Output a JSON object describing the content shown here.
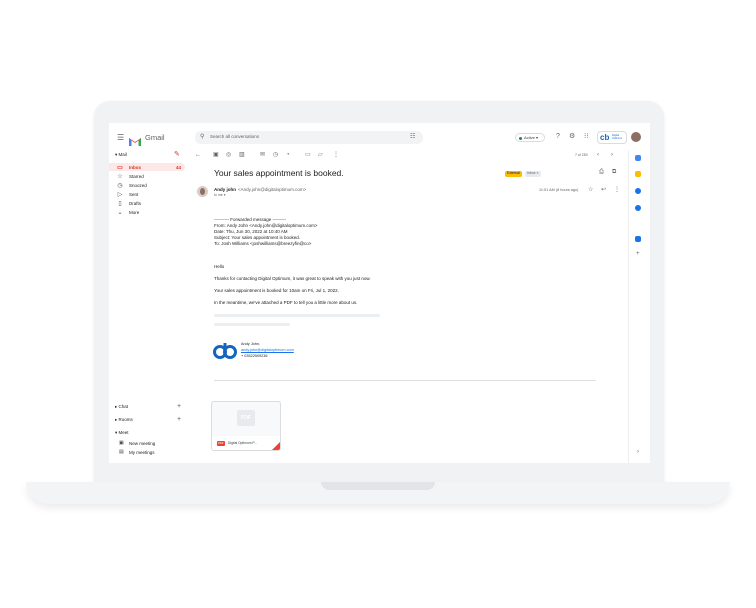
{
  "app": {
    "name": "Gmail"
  },
  "search": {
    "placeholder": "Search all conversations"
  },
  "status": {
    "label": "Active ▾"
  },
  "brand": {
    "small": "Digital Optimum"
  },
  "sidebar": {
    "section_mail": "▾ Mail",
    "items": [
      {
        "label": "Inbox",
        "count": "44"
      },
      {
        "label": "Starred"
      },
      {
        "label": "Snoozed"
      },
      {
        "label": "Sent"
      },
      {
        "label": "Drafts"
      },
      {
        "label": "More"
      }
    ],
    "chat": "▸ Chat",
    "rooms": "▸ Rooms",
    "meet": "▾ Meet",
    "new_meeting": "New meeting",
    "my_meetings": "My meetings"
  },
  "toolbar": {
    "pager": "7 of 283"
  },
  "email": {
    "subject": "Your sales appointment is booked.",
    "labels": [
      "External",
      "Inbox ×"
    ],
    "sender_name": "Andy john",
    "sender_email": "<Andy.john@digitaloptimum.com>",
    "to": "to me ▾",
    "time": "11:51 AM (8 hours ago)",
    "forwarded": [
      "---------- Forwarded message ---------",
      "From: Andy John <Andy.john@digitaloptimum.com>",
      "Date: Thu, Jun 30, 2022 at 10:40 AM",
      "Subject: Your sales appointment is booked.",
      "To: Josh Williams <joshwilliams@breezyfin@co>"
    ],
    "greeting": "Hello",
    "p1": "Thanks for contacting Digital Optimum, it was great to speak with you just now.",
    "p2": "Your sales appointment is booked for 10am on Fri, Jul 1, 2022.",
    "p3": "In the meantime, we've attached a PDF to tell you a little more about us.",
    "sig_name": "Andy John,",
    "sig_email": "andy.john@digitaloptimum.com",
    "sig_phone": "+ 03522509236",
    "attachment_name": "Digital Optimum P..."
  },
  "colors": {
    "accent": "#d93025",
    "brand": "#1565c0",
    "label_external": "#fbbc04"
  }
}
